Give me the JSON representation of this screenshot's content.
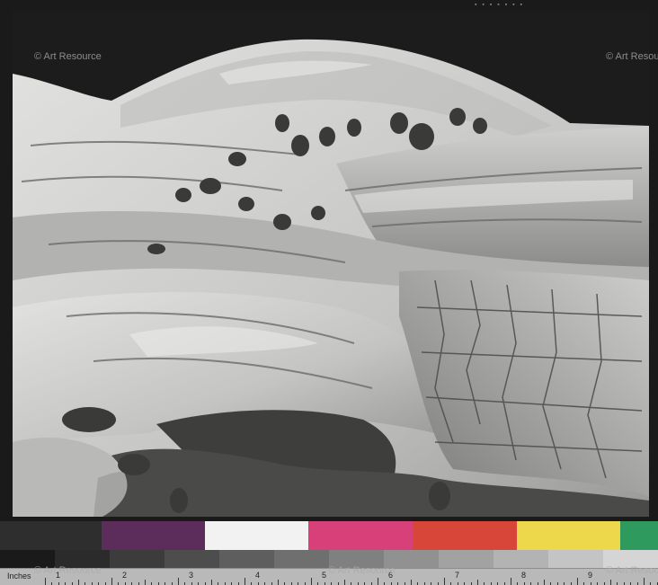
{
  "watermark": {
    "text": "© Art Resource"
  },
  "edge_marks": {
    "top": "▪ ▪ ▪ ▪ ▪ ▪ ▪"
  },
  "ruler": {
    "label": "Inches",
    "numbers": [
      "1",
      "2",
      "3",
      "4",
      "5",
      "6",
      "7",
      "8",
      "9"
    ]
  },
  "colors": {
    "sky": "#1b1b1b",
    "rock_light": "#d8d8d6",
    "rock_mid": "#a8a8a6",
    "rock_dark": "#5e5e5c",
    "swatches": [
      "#2e2e2e",
      "#5c2d5a",
      "#f2f2f2",
      "#d8407a",
      "#d8463a",
      "#ecd84a",
      "#2e9a5e"
    ],
    "grays": [
      "#1a1a1a",
      "#2b2b2b",
      "#3c3c3c",
      "#4d4d4d",
      "#5e5e5e",
      "#6f6f6f",
      "#808080",
      "#919191",
      "#a2a2a2",
      "#b3b3b3",
      "#c4c4c4",
      "#d5d5d5"
    ]
  }
}
